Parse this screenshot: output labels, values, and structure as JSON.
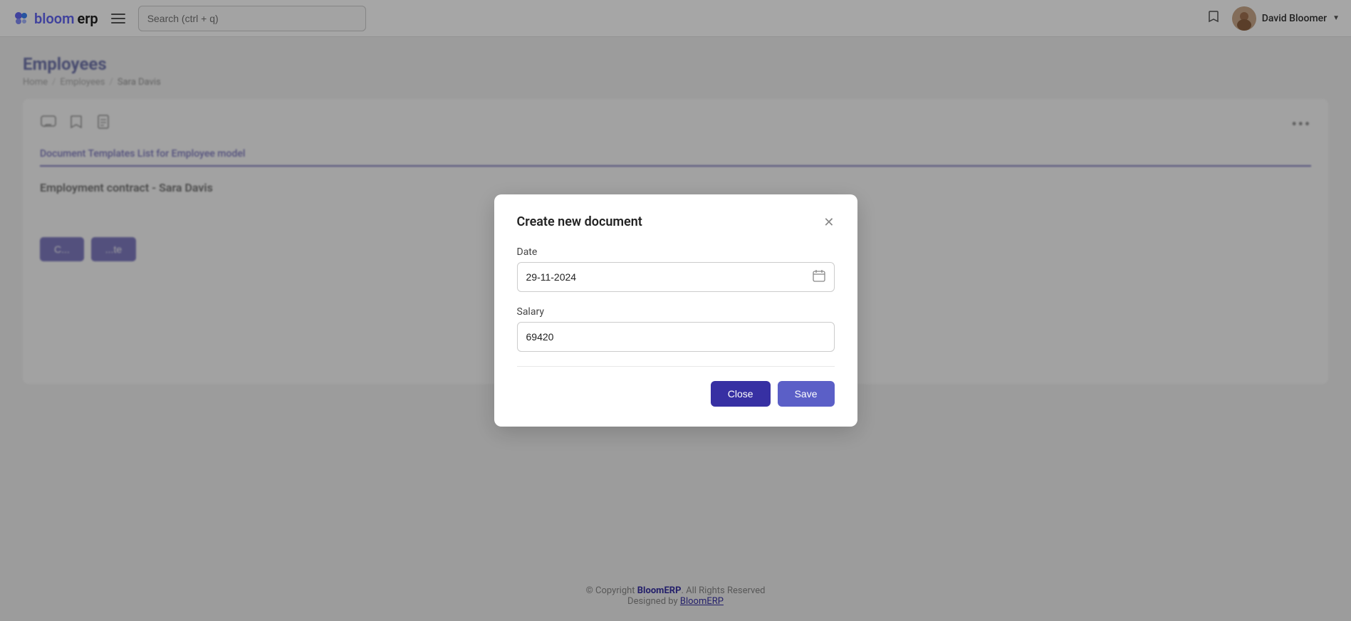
{
  "app": {
    "logo_text_bloom": "bloom",
    "logo_text_erp": "erp",
    "search_placeholder": "Search (ctrl + q)"
  },
  "topnav": {
    "user_name": "David Bloomer",
    "bookmark_icon": "bookmark-icon",
    "hamburger_icon": "hamburger-icon"
  },
  "breadcrumb": {
    "home": "Home",
    "employees": "Employees",
    "current": "Sara Davis",
    "sep": "/"
  },
  "page": {
    "title": "Employees"
  },
  "card": {
    "tab_label": "Document Templates List for Employee model",
    "section_heading": "Employment contract - Sara Davis",
    "more_dots": "•••"
  },
  "modal": {
    "title": "Create new document",
    "date_label": "Date",
    "date_value": "29-11-2024",
    "salary_label": "Salary",
    "salary_value": "69420",
    "close_label": "Close",
    "save_label": "Save"
  },
  "footer": {
    "copyright": "© Copyright ",
    "brand": "BloomERP",
    "rights": ". All Rights Reserved",
    "designed_by": "Designed by ",
    "designed_brand": "BloomERP"
  }
}
